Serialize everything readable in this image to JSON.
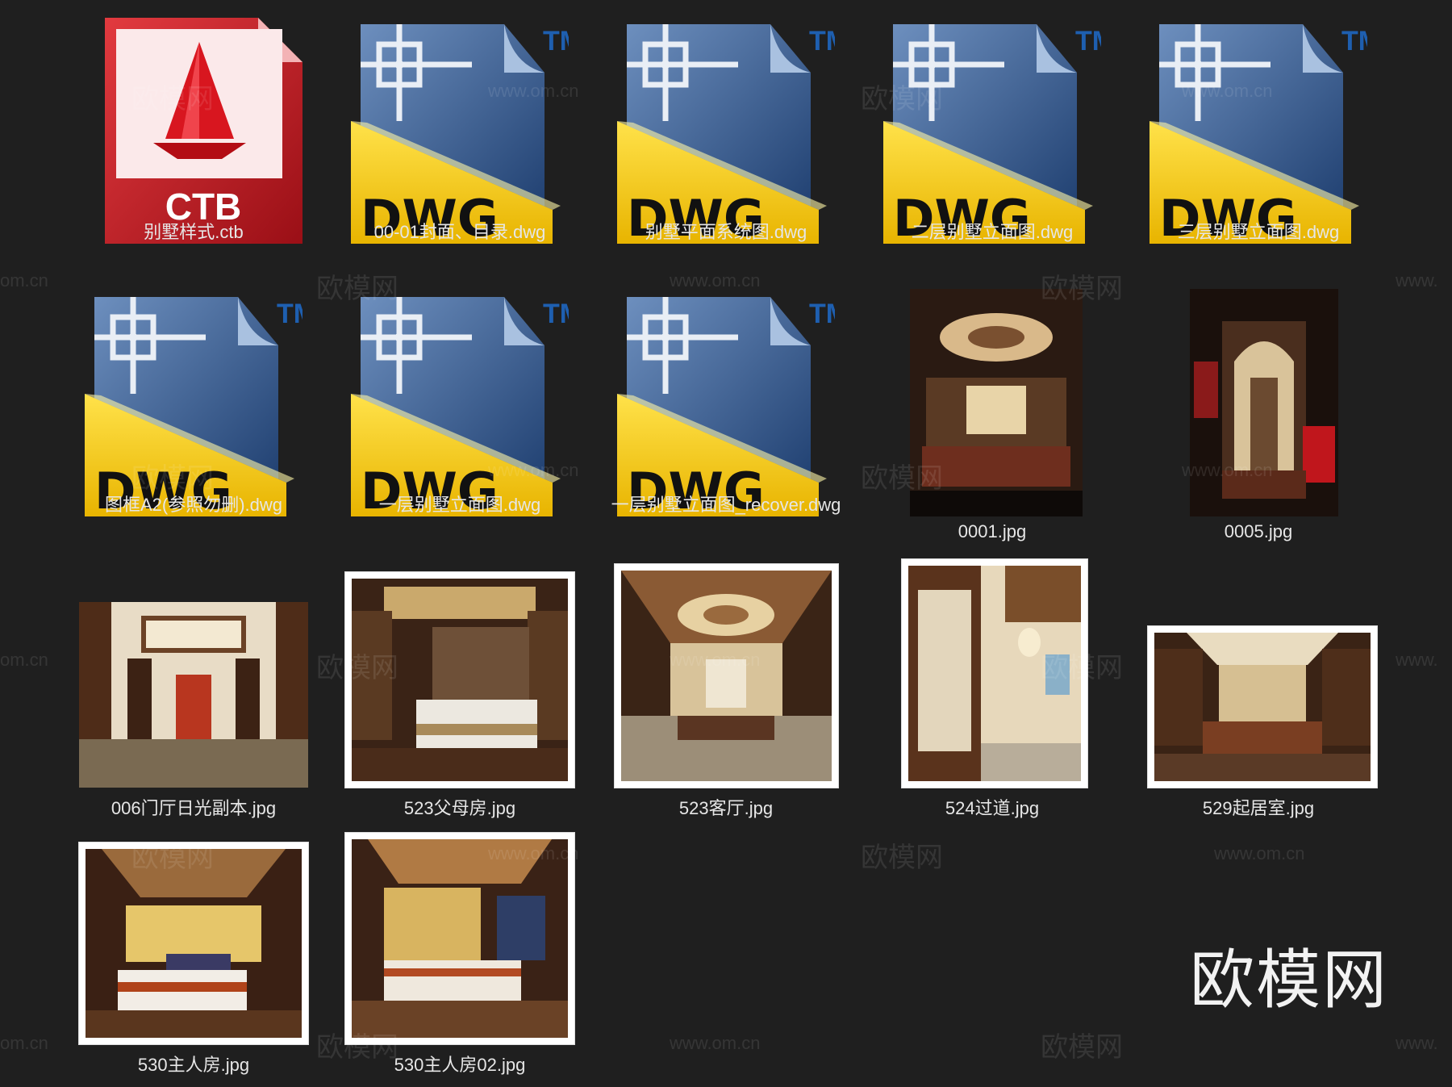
{
  "files": [
    {
      "name": "别墅样式.ctb",
      "type": "ctb",
      "ext_label": "CTB"
    },
    {
      "name": "00-01封面、目录.dwg",
      "type": "dwg",
      "ext_label": "DWG"
    },
    {
      "name": "别墅平面系统图.dwg",
      "type": "dwg",
      "ext_label": "DWG"
    },
    {
      "name": "二层别墅立面图.dwg",
      "type": "dwg",
      "ext_label": "DWG"
    },
    {
      "name": "三层别墅立面图.dwg",
      "type": "dwg",
      "ext_label": "DWG"
    },
    {
      "name": "图框A2(参照勿删).dwg",
      "type": "dwg",
      "ext_label": "DWG"
    },
    {
      "name": "一层别墅立面图.dwg",
      "type": "dwg",
      "ext_label": "DWG"
    },
    {
      "name": "一层别墅立面图_recover.dwg",
      "type": "dwg",
      "ext_label": "DWG"
    },
    {
      "name": "0001.jpg",
      "type": "jpg"
    },
    {
      "name": "0005.jpg",
      "type": "jpg"
    },
    {
      "name": "006门厅日光副本.jpg",
      "type": "jpg"
    },
    {
      "name": "523父母房.jpg",
      "type": "jpg"
    },
    {
      "name": "523客厅.jpg",
      "type": "jpg"
    },
    {
      "name": "524过道.jpg",
      "type": "jpg"
    },
    {
      "name": "529起居室.jpg",
      "type": "jpg"
    },
    {
      "name": "530主人房.jpg",
      "type": "jpg"
    },
    {
      "name": "530主人房02.jpg",
      "type": "jpg"
    }
  ],
  "icon_tm": "TM",
  "watermarks": {
    "cn": "欧模网",
    "url": "www.om.cn",
    "url_left": "om.cn",
    "url_right": "www."
  },
  "brand_mark": "欧模网",
  "colors": {
    "background": "#1f1f1f",
    "dwg_yellow": "#f2c500",
    "dwg_blue": "#3a5f93",
    "ctb_red": "#c8141c"
  }
}
